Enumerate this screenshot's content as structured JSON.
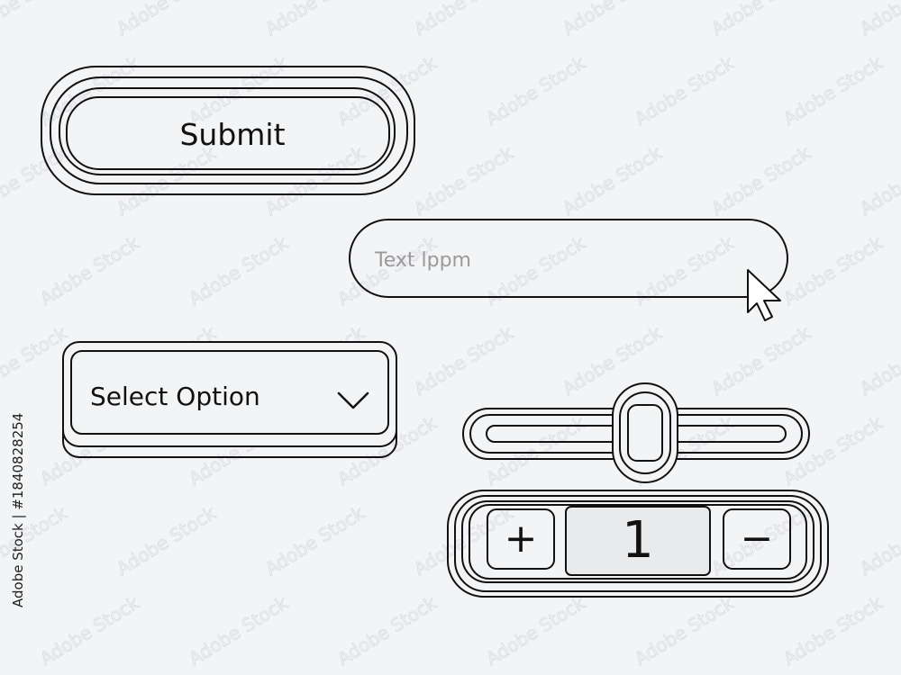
{
  "submit_button": {
    "label": "Submit"
  },
  "text_input": {
    "placeholder": "Text lppm"
  },
  "select": {
    "label": "Select Option",
    "icon": "chevron-down-icon"
  },
  "slider": {
    "value_fraction": 0.5
  },
  "stepper": {
    "plus_label": "+",
    "value": "1",
    "minus_label": "−"
  },
  "cursor": {
    "icon": "arrow-cursor-icon"
  },
  "watermark": {
    "text": "Adobe Stock"
  },
  "credit": {
    "text": "Adobe Stock | #1840828254"
  },
  "colors": {
    "background": "#f3f4f6",
    "stroke": "#111111",
    "placeholder": "#9a9a9a"
  }
}
